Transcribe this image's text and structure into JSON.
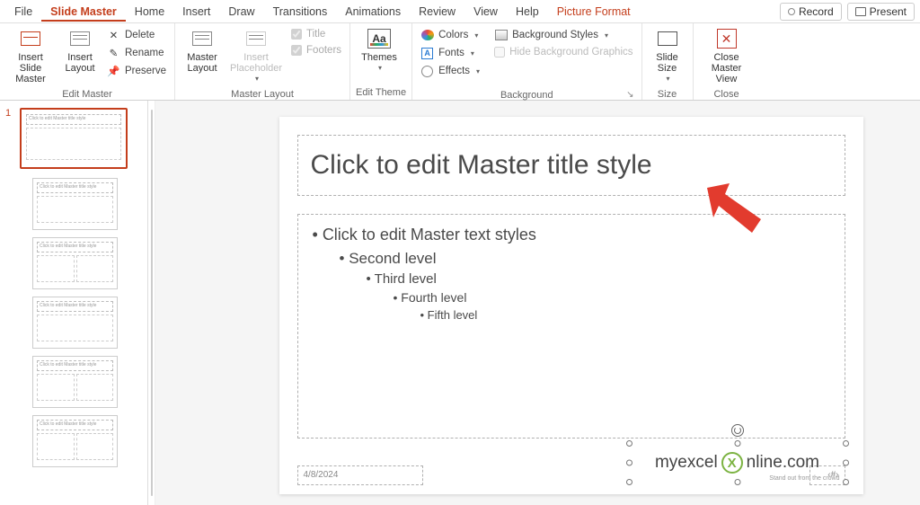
{
  "tabs": {
    "file": "File",
    "slide_master": "Slide Master",
    "home": "Home",
    "insert": "Insert",
    "draw": "Draw",
    "transitions": "Transitions",
    "animations": "Animations",
    "review": "Review",
    "view": "View",
    "help": "Help",
    "picture_format": "Picture Format"
  },
  "topright": {
    "record": "Record",
    "present": "Present"
  },
  "ribbon": {
    "edit_master": {
      "label": "Edit Master",
      "insert_slide_master": "Insert Slide Master",
      "insert_layout": "Insert Layout",
      "delete": "Delete",
      "rename": "Rename",
      "preserve": "Preserve"
    },
    "master_layout": {
      "label": "Master Layout",
      "master_layout_btn": "Master Layout",
      "insert_placeholder": "Insert Placeholder",
      "title": "Title",
      "footers": "Footers"
    },
    "edit_theme": {
      "label": "Edit Theme",
      "themes": "Themes"
    },
    "background": {
      "label": "Background",
      "colors": "Colors",
      "fonts": "Fonts",
      "effects": "Effects",
      "bg_styles": "Background Styles",
      "hide_bg": "Hide Background Graphics"
    },
    "size": {
      "label": "Size",
      "slide_size": "Slide Size"
    },
    "close": {
      "label": "Close",
      "close_master": "Close Master View"
    }
  },
  "slide": {
    "title": "Click to edit Master title style",
    "lvl1": "Click to edit Master text styles",
    "lvl2": "Second level",
    "lvl3": "Third level",
    "lvl4": "Fourth level",
    "lvl5": "Fifth level",
    "date": "4/8/2024",
    "slidenum": "‹#›"
  },
  "thumb": {
    "master_index": "1",
    "title_text": "Click to edit Master title style"
  },
  "logo": {
    "pre": "myexcel",
    "post": "nline.com",
    "tag": "Stand out from the crowd"
  }
}
